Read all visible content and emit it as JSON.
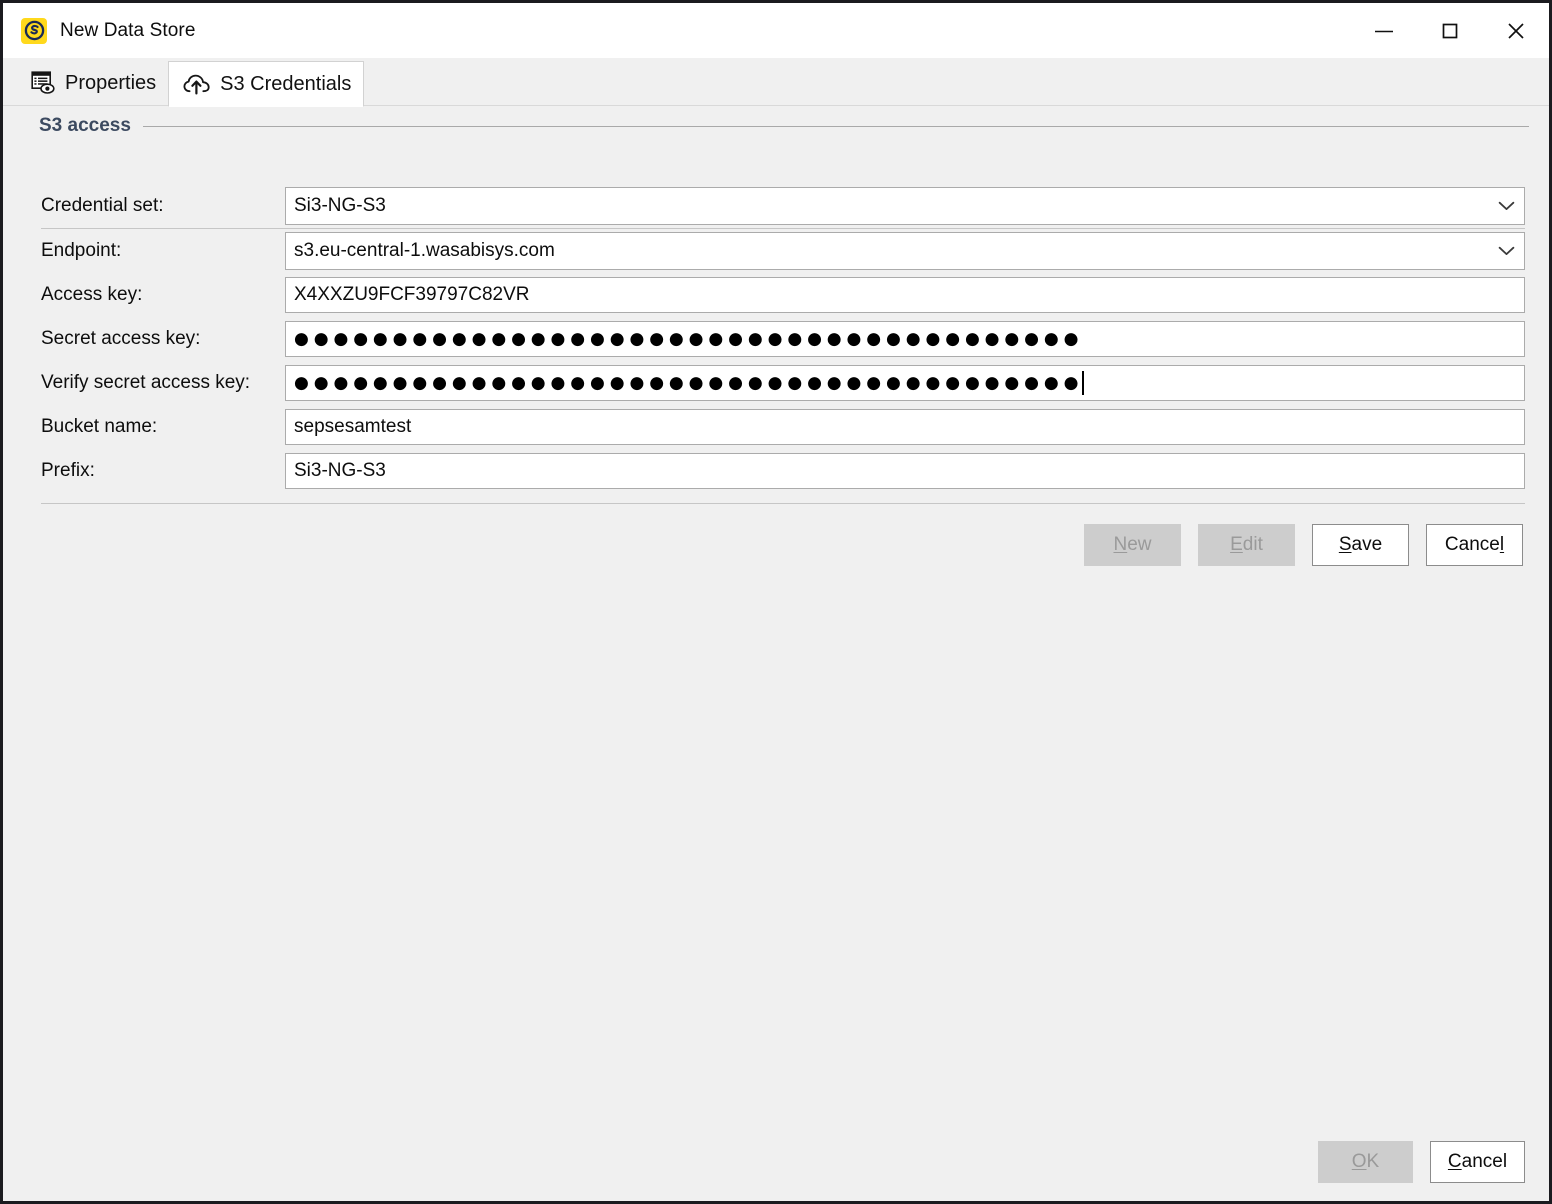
{
  "window": {
    "title": "New Data Store",
    "icon": "app-logo-icon",
    "controls": [
      {
        "name": "minimize-button",
        "glyph": "minimize-icon"
      },
      {
        "name": "maximize-button",
        "glyph": "maximize-icon"
      },
      {
        "name": "close-button",
        "glyph": "close-icon"
      }
    ]
  },
  "tabs": [
    {
      "label": "Properties",
      "icon": "properties-list-eye-icon",
      "active": false
    },
    {
      "label": "S3 Credentials",
      "icon": "cloud-upload-icon",
      "active": true
    }
  ],
  "group": {
    "title": "S3 access"
  },
  "form": {
    "credential_set": {
      "label": "Credential set:",
      "value": "Si3-NG-S3",
      "type": "combobox"
    },
    "endpoint": {
      "label": "Endpoint:",
      "value": "s3.eu-central-1.wasabisys.com",
      "type": "combobox"
    },
    "access_key": {
      "label": "Access key:",
      "value": "X4XXZU9FCF39797C82VR",
      "type": "text"
    },
    "secret_access_key": {
      "label": "Secret access key:",
      "value": "●●●●●●●●●●●●●●●●●●●●●●●●●●●●●●●●●●●●●●●●",
      "type": "password"
    },
    "verify_secret_access_key": {
      "label": "Verify secret access key:",
      "value": "●●●●●●●●●●●●●●●●●●●●●●●●●●●●●●●●●●●●●●●●",
      "type": "password",
      "focused": true
    },
    "bucket_name": {
      "label": "Bucket name:",
      "value": "sepsesamtest",
      "type": "text"
    },
    "prefix": {
      "label": "Prefix:",
      "value": "Si3-NG-S3",
      "type": "text"
    }
  },
  "credential_buttons": [
    {
      "name": "new-button",
      "label": "New",
      "mnemonic": "N",
      "enabled": false
    },
    {
      "name": "edit-button",
      "label": "Edit",
      "mnemonic": "E",
      "enabled": false
    },
    {
      "name": "save-button",
      "label": "Save",
      "mnemonic": "S",
      "enabled": true
    },
    {
      "name": "cancel-credentials-button",
      "label": "Cancel",
      "mnemonic": "l",
      "enabled": true
    }
  ],
  "dialog_buttons": [
    {
      "name": "ok-button",
      "label": "OK",
      "mnemonic": "O",
      "enabled": false
    },
    {
      "name": "cancel-button",
      "label": "Cancel",
      "mnemonic": "C",
      "enabled": true
    }
  ],
  "colors": {
    "window_bg": "#f0f0f0",
    "titlebar_bg": "#ffffff",
    "group_title": "#3c4a60",
    "accent_icon": "#ffd91c",
    "disabled_text": "#9a9a9a"
  }
}
